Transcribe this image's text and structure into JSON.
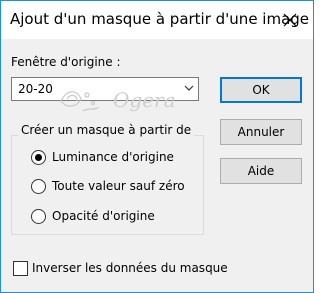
{
  "window": {
    "title": "Ajout d'un masque à partir d'une image",
    "close_icon": "close-icon"
  },
  "source": {
    "label": "Fenêtre d'origine :",
    "selected": "20-20"
  },
  "buttons": {
    "ok": "OK",
    "cancel": "Annuler",
    "help": "Aide"
  },
  "mask_group": {
    "title": "Créer un masque à partir de",
    "options": [
      {
        "label": "Luminance d'origine",
        "checked": true
      },
      {
        "label": "Toute valeur sauf zéro",
        "checked": false
      },
      {
        "label": "Opacité d'origine",
        "checked": false
      }
    ]
  },
  "invert": {
    "label": "Inverser les données du masque",
    "checked": false
  },
  "watermark": {
    "text": "Ogera"
  },
  "colors": {
    "border_accent": "#1e8fd8",
    "default_button_border": "#0078d7"
  }
}
